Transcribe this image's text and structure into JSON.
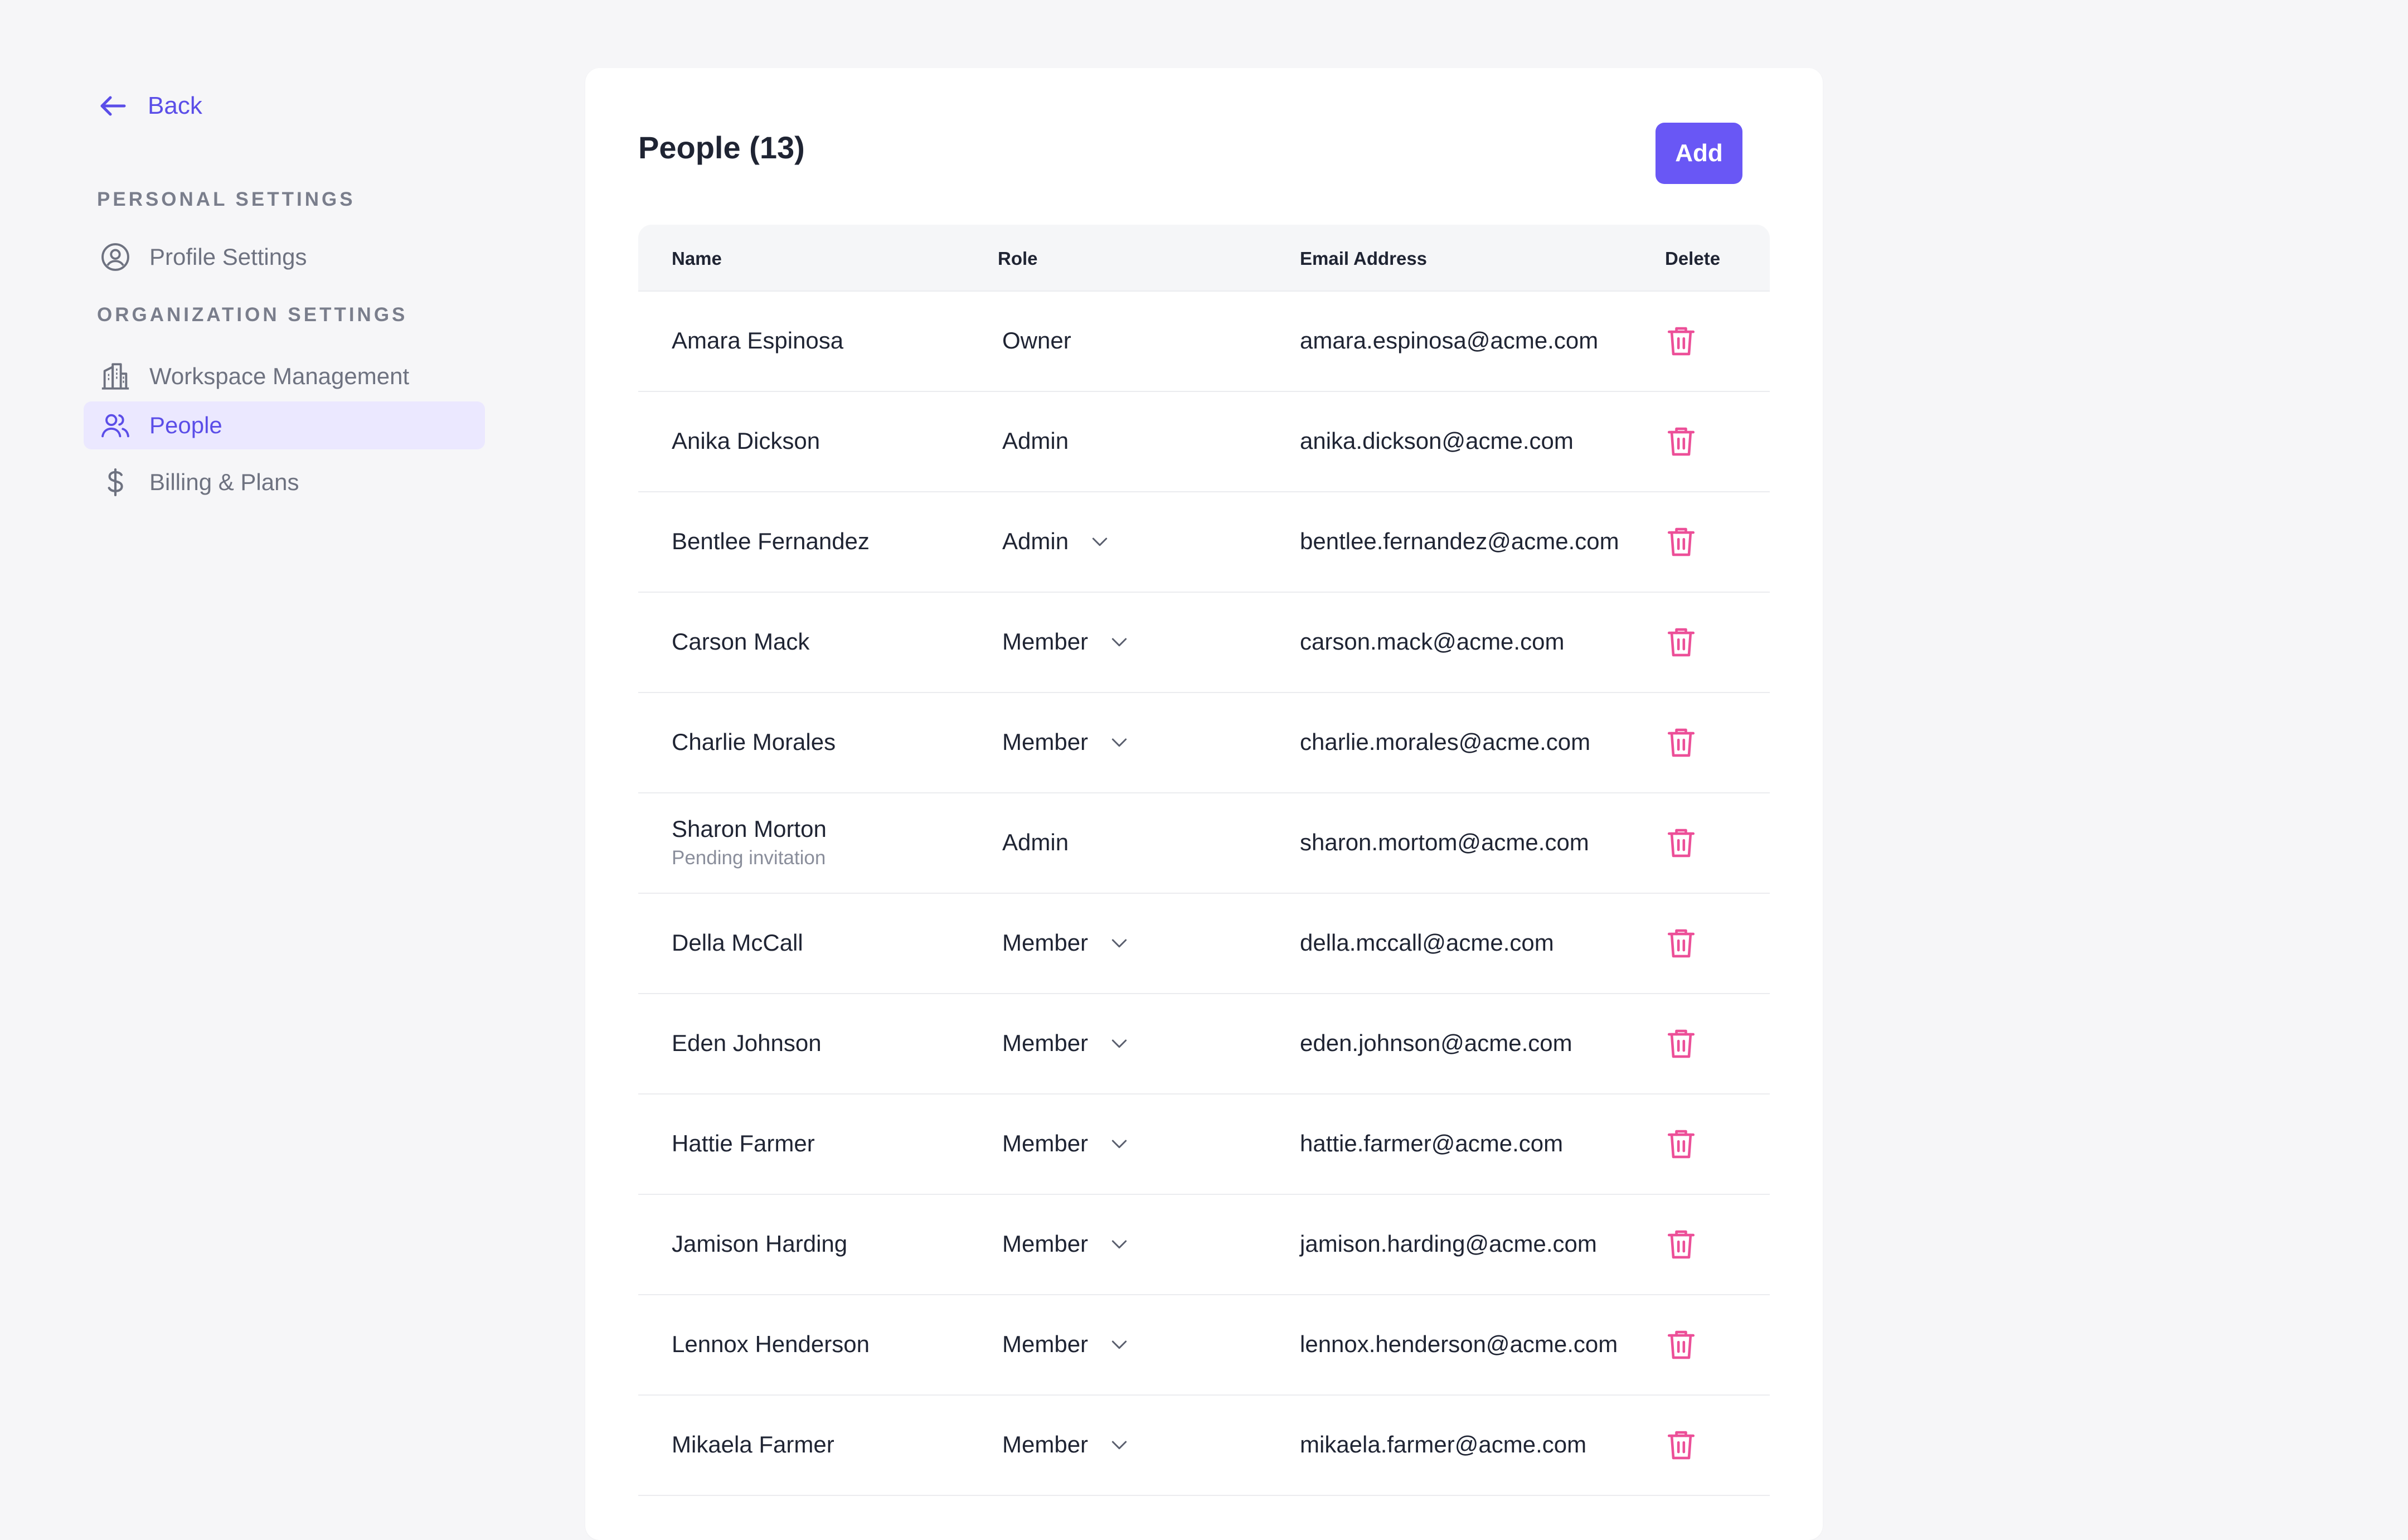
{
  "sidebar": {
    "back_label": "Back",
    "personal_title": "PERSONAL SETTINGS",
    "profile_label": "Profile Settings",
    "org_title": "ORGANIZATION SETTINGS",
    "workspace_label": "Workspace Management",
    "people_label": "People",
    "billing_label": "Billing & Plans"
  },
  "main": {
    "title": "People (13)",
    "add_label": "Add",
    "columns": {
      "name": "Name",
      "role": "Role",
      "email": "Email Address",
      "delete": "Delete"
    },
    "rows": [
      {
        "name": "Amara Espinosa",
        "role": "Owner",
        "email": "amara.espinosa@acme.com"
      },
      {
        "name": "Anika Dickson",
        "role": "Admin",
        "email": "anika.dickson@acme.com"
      },
      {
        "name": "Bentlee Fernandez",
        "role": "Admin",
        "email": "bentlee.fernandez@acme.com"
      },
      {
        "name": "Carson Mack",
        "role": "Member",
        "email": "carson.mack@acme.com"
      },
      {
        "name": "Charlie Morales",
        "role": "Member",
        "email": "charlie.morales@acme.com"
      },
      {
        "name": "Sharon Morton",
        "status": "Pending invitation",
        "role": "Admin",
        "email": "sharon.mortom@acme.com"
      },
      {
        "name": "Della McCall",
        "role": "Member",
        "email": "della.mccall@acme.com"
      },
      {
        "name": "Eden Johnson",
        "role": "Member",
        "email": "eden.johnson@acme.com"
      },
      {
        "name": "Hattie Farmer",
        "role": "Member",
        "email": "hattie.farmer@acme.com"
      },
      {
        "name": "Jamison Harding",
        "role": "Member",
        "email": "jamison.harding@acme.com"
      },
      {
        "name": "Lennox Henderson",
        "role": "Member",
        "email": "lennox.henderson@acme.com"
      },
      {
        "name": "Mikaela Farmer",
        "role": "Member",
        "email": "mikaela.farmer@acme.com"
      }
    ]
  },
  "colors": {
    "accent": "#6957f5",
    "accent_text": "#5b4ee8",
    "active_bg": "#ebe8ff",
    "delete": "#ec4f98"
  },
  "icons": [
    "arrow-left-icon",
    "user-circle-icon",
    "building-icon",
    "users-icon",
    "dollar-icon",
    "chevron-down-icon",
    "trash-icon"
  ]
}
